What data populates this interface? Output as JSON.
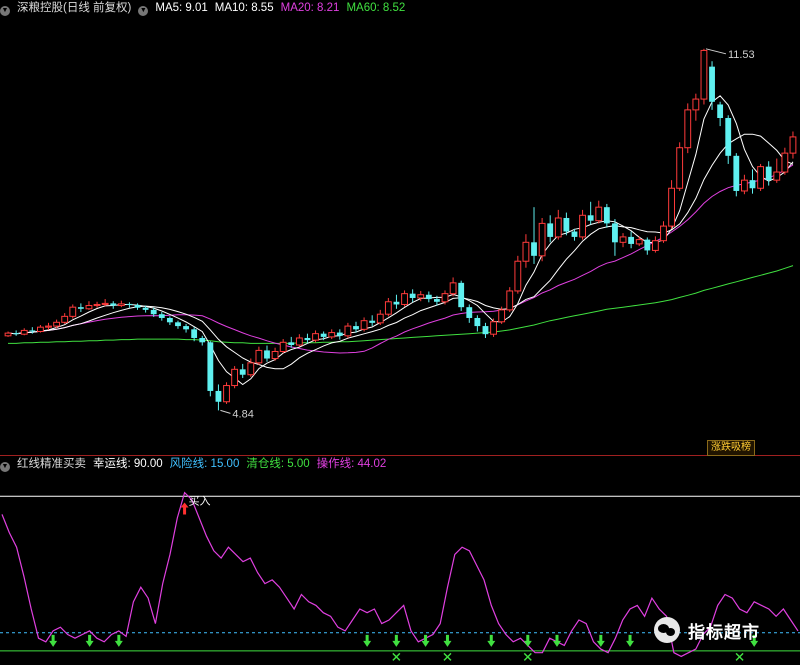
{
  "main_header": {
    "title": "深粮控股(日线 前复权)",
    "ma5": "MA5: 9.01",
    "ma10": "MA10: 8.55",
    "ma20": "MA20: 8.21",
    "ma60": "MA60: 8.52",
    "colors": {
      "title": "#d8d8d8",
      "ma5": "#ffffff",
      "ma10": "#ffffff",
      "ma20": "#e040e0",
      "ma60": "#40e040"
    }
  },
  "indicator_header": {
    "title": "红线精准买卖",
    "luck": "幸运线: 90.00",
    "risk": "风险线: 15.00",
    "clear": "清仓线: 5.00",
    "op": "操作线: 44.02",
    "colors": {
      "title": "#d8d8d8",
      "luck": "#ffffff",
      "risk": "#40c0ff",
      "clear": "#40e040",
      "op": "#e040e0"
    }
  },
  "badge": "涨跌吸榜",
  "watermark": "指标超市",
  "chart_data": [
    {
      "type": "candlestick",
      "title": "深粮控股(日线 前复权)",
      "ylim": [
        4.2,
        12.1
      ],
      "annotations": [
        {
          "text": "11.53",
          "kind": "max"
        },
        {
          "text": "4.84",
          "kind": "min"
        }
      ],
      "colors": {
        "up": "#ff3b3b",
        "down": "#5ff0f0",
        "ma5": "#ffffff",
        "ma10": "#ffffff",
        "ma20": "#e040e0",
        "ma60": "#40e040"
      },
      "candles": [
        [
          6.22,
          6.27,
          6.2,
          6.3
        ],
        [
          6.27,
          6.25,
          6.22,
          6.32
        ],
        [
          6.25,
          6.32,
          6.23,
          6.36
        ],
        [
          6.32,
          6.3,
          6.26,
          6.38
        ],
        [
          6.3,
          6.38,
          6.28,
          6.42
        ],
        [
          6.38,
          6.4,
          6.33,
          6.46
        ],
        [
          6.4,
          6.47,
          6.36,
          6.52
        ],
        [
          6.47,
          6.58,
          6.44,
          6.64
        ],
        [
          6.58,
          6.75,
          6.54,
          6.8
        ],
        [
          6.75,
          6.72,
          6.66,
          6.82
        ],
        [
          6.72,
          6.78,
          6.7,
          6.86
        ],
        [
          6.78,
          6.8,
          6.74,
          6.85
        ],
        [
          6.8,
          6.82,
          6.77,
          6.9
        ],
        [
          6.82,
          6.78,
          6.72,
          6.86
        ],
        [
          6.78,
          6.81,
          6.75,
          6.87
        ],
        [
          6.81,
          6.79,
          6.74,
          6.84
        ],
        [
          6.79,
          6.74,
          6.7,
          6.82
        ],
        [
          6.74,
          6.7,
          6.65,
          6.78
        ],
        [
          6.7,
          6.62,
          6.57,
          6.74
        ],
        [
          6.62,
          6.55,
          6.5,
          6.66
        ],
        [
          6.55,
          6.47,
          6.42,
          6.58
        ],
        [
          6.47,
          6.4,
          6.35,
          6.5
        ],
        [
          6.4,
          6.34,
          6.28,
          6.44
        ],
        [
          6.34,
          6.18,
          6.12,
          6.38
        ],
        [
          6.18,
          6.1,
          6.04,
          6.22
        ],
        [
          6.1,
          5.2,
          5.1,
          6.12
        ],
        [
          5.2,
          5.0,
          4.84,
          5.32
        ],
        [
          5.0,
          5.3,
          4.96,
          5.36
        ],
        [
          5.3,
          5.6,
          5.25,
          5.66
        ],
        [
          5.6,
          5.5,
          5.44,
          5.7
        ],
        [
          5.5,
          5.72,
          5.46,
          5.8
        ],
        [
          5.72,
          5.95,
          5.68,
          6.02
        ],
        [
          5.95,
          5.8,
          5.74,
          6.04
        ],
        [
          5.8,
          5.93,
          5.76,
          6.0
        ],
        [
          5.93,
          6.1,
          5.9,
          6.16
        ],
        [
          6.1,
          6.05,
          6.0,
          6.2
        ],
        [
          6.05,
          6.18,
          6.02,
          6.25
        ],
        [
          6.18,
          6.14,
          6.08,
          6.26
        ],
        [
          6.14,
          6.26,
          6.1,
          6.32
        ],
        [
          6.26,
          6.2,
          6.14,
          6.3
        ],
        [
          6.2,
          6.28,
          6.16,
          6.34
        ],
        [
          6.28,
          6.22,
          6.15,
          6.34
        ],
        [
          6.22,
          6.4,
          6.18,
          6.46
        ],
        [
          6.4,
          6.34,
          6.28,
          6.48
        ],
        [
          6.34,
          6.5,
          6.3,
          6.56
        ],
        [
          6.5,
          6.46,
          6.4,
          6.6
        ],
        [
          6.46,
          6.62,
          6.42,
          6.7
        ],
        [
          6.62,
          6.85,
          6.58,
          6.92
        ],
        [
          6.85,
          6.8,
          6.72,
          6.98
        ],
        [
          6.8,
          7.0,
          6.76,
          7.06
        ],
        [
          7.0,
          6.92,
          6.84,
          7.08
        ],
        [
          6.92,
          6.98,
          6.86,
          7.05
        ],
        [
          6.98,
          6.9,
          6.84,
          7.04
        ],
        [
          6.9,
          6.85,
          6.78,
          6.96
        ],
        [
          6.85,
          7.0,
          6.8,
          7.06
        ],
        [
          7.0,
          7.2,
          6.95,
          7.3
        ],
        [
          7.2,
          6.75,
          6.68,
          7.24
        ],
        [
          6.75,
          6.55,
          6.46,
          6.8
        ],
        [
          6.55,
          6.4,
          6.3,
          6.6
        ],
        [
          6.4,
          6.25,
          6.18,
          6.46
        ],
        [
          6.25,
          6.48,
          6.2,
          6.54
        ],
        [
          6.48,
          6.7,
          6.44,
          6.76
        ],
        [
          6.7,
          7.05,
          6.66,
          7.12
        ],
        [
          7.05,
          7.6,
          7.0,
          7.7
        ],
        [
          7.6,
          7.95,
          7.48,
          8.1
        ],
        [
          7.95,
          7.7,
          7.55,
          8.6
        ],
        [
          7.7,
          8.3,
          7.6,
          8.4
        ],
        [
          8.3,
          8.05,
          7.95,
          8.45
        ],
        [
          8.05,
          8.4,
          8.0,
          8.55
        ],
        [
          8.4,
          8.15,
          8.08,
          8.5
        ],
        [
          8.15,
          8.05,
          7.98,
          8.2
        ],
        [
          8.05,
          8.45,
          8.0,
          8.55
        ],
        [
          8.45,
          8.35,
          8.28,
          8.7
        ],
        [
          8.35,
          8.6,
          8.3,
          8.72
        ],
        [
          8.6,
          8.3,
          8.22,
          8.66
        ],
        [
          8.3,
          7.95,
          7.7,
          8.38
        ],
        [
          7.95,
          8.05,
          7.86,
          8.12
        ],
        [
          8.05,
          7.92,
          7.84,
          8.15
        ],
        [
          7.92,
          8.0,
          7.88,
          8.06
        ],
        [
          8.0,
          7.8,
          7.72,
          8.04
        ],
        [
          7.8,
          7.98,
          7.76,
          8.06
        ],
        [
          7.98,
          8.25,
          7.94,
          8.34
        ],
        [
          8.25,
          8.95,
          8.2,
          9.1
        ],
        [
          8.95,
          9.7,
          8.9,
          9.8
        ],
        [
          9.7,
          10.4,
          9.6,
          10.52
        ],
        [
          10.4,
          10.6,
          10.2,
          10.7
        ],
        [
          10.6,
          11.5,
          10.5,
          11.53
        ],
        [
          11.2,
          10.55,
          10.4,
          11.3
        ],
        [
          10.5,
          10.25,
          10.1,
          10.55
        ],
        [
          10.25,
          9.55,
          9.4,
          10.3
        ],
        [
          9.55,
          8.9,
          8.8,
          9.6
        ],
        [
          8.9,
          9.1,
          8.84,
          9.2
        ],
        [
          9.1,
          8.95,
          8.85,
          9.3
        ],
        [
          8.95,
          9.35,
          8.9,
          9.4
        ],
        [
          9.35,
          9.1,
          9.0,
          9.45
        ],
        [
          9.1,
          9.25,
          9.05,
          9.5
        ],
        [
          9.25,
          9.6,
          9.2,
          9.7
        ],
        [
          9.6,
          9.9,
          9.5,
          10.0
        ]
      ],
      "ma60_values": [
        6.08,
        6.08,
        6.09,
        6.09,
        6.1,
        6.1,
        6.11,
        6.11,
        6.12,
        6.12,
        6.13,
        6.13,
        6.14,
        6.14,
        6.15,
        6.15,
        6.16,
        6.16,
        6.16,
        6.16,
        6.16,
        6.16,
        6.15,
        6.15,
        6.14,
        6.13,
        6.11,
        6.1,
        6.09,
        6.09,
        6.08,
        6.08,
        6.08,
        6.08,
        6.08,
        6.08,
        6.09,
        6.09,
        6.09,
        6.1,
        6.1,
        6.11,
        6.11,
        6.12,
        6.13,
        6.14,
        6.15,
        6.16,
        6.17,
        6.18,
        6.19,
        6.2,
        6.21,
        6.22,
        6.23,
        6.24,
        6.25,
        6.26,
        6.27,
        6.28,
        6.29,
        6.31,
        6.33,
        6.36,
        6.39,
        6.42,
        6.46,
        6.5,
        6.53,
        6.56,
        6.59,
        6.62,
        6.65,
        6.68,
        6.71,
        6.73,
        6.75,
        6.77,
        6.79,
        6.81,
        6.83,
        6.86,
        6.89,
        6.93,
        6.97,
        7.01,
        7.06,
        7.1,
        7.14,
        7.18,
        7.22,
        7.26,
        7.3,
        7.34,
        7.38,
        7.42,
        7.47,
        7.52
      ]
    },
    {
      "type": "line",
      "title": "红线精准买卖",
      "ylim": [
        0,
        100
      ],
      "reference_lines": [
        {
          "name": "幸运线",
          "value": 90,
          "color": "#ffffff"
        },
        {
          "name": "风险线",
          "value": 15,
          "color": "#40c0ff",
          "dashed": true
        },
        {
          "name": "清仓线",
          "value": 5,
          "color": "#40e040"
        }
      ],
      "series": [
        {
          "name": "操作线",
          "color": "#e040e0",
          "values": [
            80,
            70,
            62,
            46,
            28,
            12,
            10,
            16,
            18,
            14,
            12,
            14,
            16,
            12,
            10,
            14,
            16,
            13,
            32,
            40,
            34,
            20,
            42,
            58,
            78,
            92,
            88,
            78,
            68,
            60,
            56,
            62,
            58,
            54,
            56,
            48,
            42,
            44,
            40,
            34,
            28,
            36,
            32,
            30,
            26,
            24,
            18,
            16,
            22,
            28,
            26,
            28,
            20,
            22,
            26,
            30,
            16,
            10,
            12,
            14,
            20,
            40,
            58,
            62,
            60,
            52,
            44,
            30,
            20,
            14,
            10,
            12,
            8,
            4,
            4,
            12,
            10,
            8,
            16,
            22,
            20,
            10,
            6,
            4,
            12,
            22,
            28,
            30,
            24,
            34,
            28,
            24,
            4,
            2,
            4,
            6,
            14,
            18,
            30,
            36,
            34,
            28,
            26,
            32,
            30,
            28,
            24,
            28,
            22,
            16
          ]
        }
      ],
      "markers": [
        {
          "type": "buy",
          "label": "买入",
          "index": 25
        },
        {
          "type": "down-arrow",
          "indices": [
            7,
            12,
            16,
            50,
            54,
            58,
            61,
            67,
            72,
            76,
            82,
            86,
            103
          ]
        },
        {
          "type": "cross",
          "indices": [
            54,
            61,
            72,
            101
          ]
        }
      ]
    }
  ]
}
